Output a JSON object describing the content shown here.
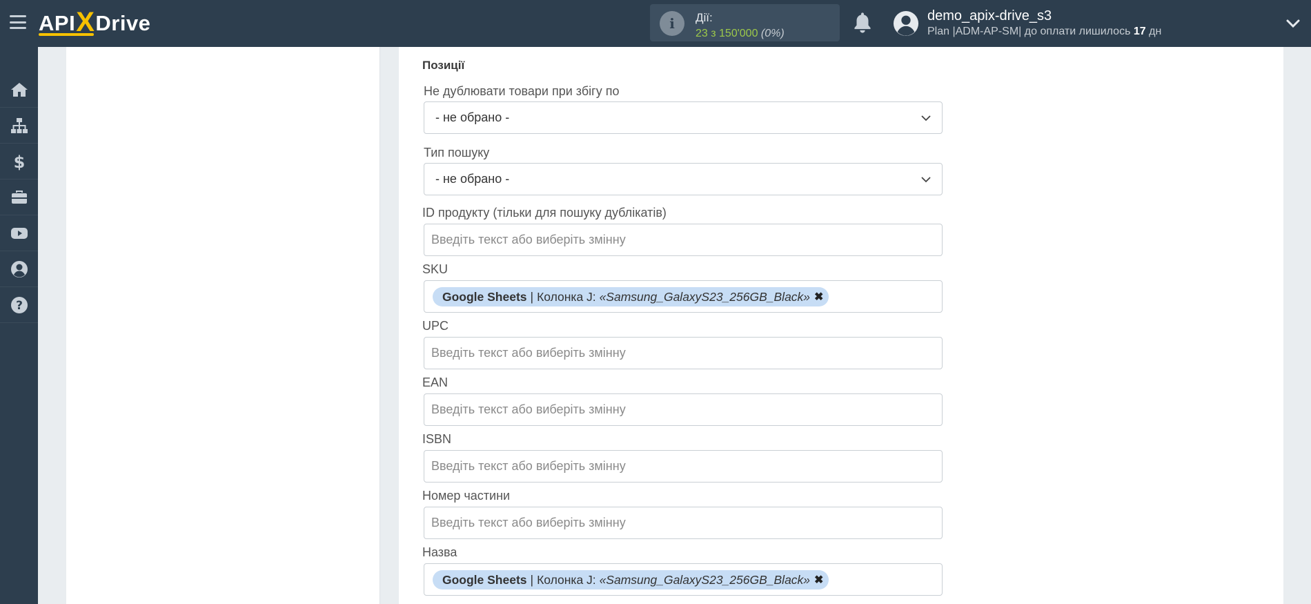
{
  "header": {
    "logo_api": "API",
    "logo_x": "X",
    "logo_drive": "Drive",
    "actions_label": "Дії:",
    "actions_count": "23 з 150'000",
    "actions_percent": "(0%)",
    "user_name": "demo_apix-drive_s3",
    "plan_prefix": "Plan |ADM-AP-SM| до оплати лишилось ",
    "plan_days": "17",
    "plan_suffix": " дн"
  },
  "sidebar": {
    "items": [
      {
        "icon": "home-icon"
      },
      {
        "icon": "sitemap-icon"
      },
      {
        "icon": "dollar-icon"
      },
      {
        "icon": "briefcase-icon"
      },
      {
        "icon": "youtube-icon"
      },
      {
        "icon": "user-circle-icon"
      },
      {
        "icon": "help-icon"
      }
    ]
  },
  "form": {
    "section_title": "Позиції",
    "no_duplicate_label": "Не дублювати товари при збігу по",
    "no_duplicate_value": "- не обрано -",
    "search_type_label": "Тип пошуку",
    "search_type_value": "- не обрано -",
    "product_id_label": "ID продукту (тільки для пошуку дублікатів)",
    "placeholder": "Введіть текст або виберіть змінну",
    "sku_label": "SKU",
    "sku_tag_source": "Google Sheets",
    "sku_tag_sep": "|",
    "sku_tag_column": "Колонка J:",
    "sku_tag_value": "«Samsung_GalaxyS23_256GB_Black»",
    "upc_label": "UPC",
    "ean_label": "EAN",
    "isbn_label": "ISBN",
    "part_number_label": "Номер частини",
    "name_label": "Назва",
    "name_tag_source": "Google Sheets",
    "name_tag_sep": "|",
    "name_tag_column": "Колонка J:",
    "name_tag_value": "«Samsung_GalaxyS23_256GB_Black»",
    "remove_glyph": "✖"
  },
  "colors": {
    "topbar": "#2d3e4e",
    "accent_yellow": "#f6c100",
    "actions_green": "#9cc84a",
    "tag_bg": "#c7ddf5"
  }
}
